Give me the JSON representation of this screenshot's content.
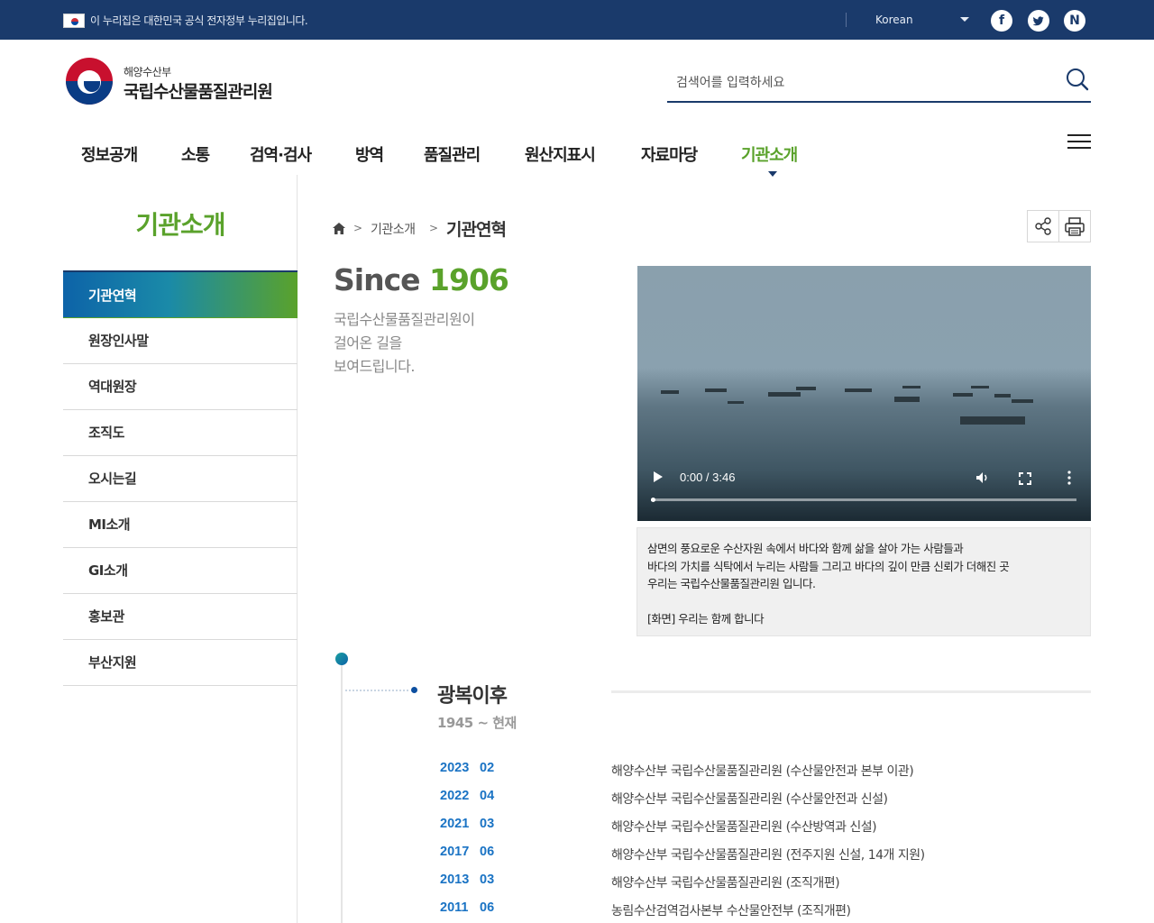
{
  "topbar": {
    "notice": "이 누리집은 대한민국 공식 전자정부 누리집입니다.",
    "language": "Korean",
    "sns": [
      "f",
      "t",
      "N"
    ]
  },
  "header": {
    "org_sub": "해양수산부",
    "org_name": "국립수산물품질관리원",
    "search_placeholder": "검색어를 입력하세요"
  },
  "gnb": [
    {
      "label": "정보공개"
    },
    {
      "label": "소통"
    },
    {
      "label": "검역·검사"
    },
    {
      "label": "방역"
    },
    {
      "label": "품질관리"
    },
    {
      "label": "원산지표시"
    },
    {
      "label": "자료마당"
    },
    {
      "label": "기관소개",
      "active": true
    }
  ],
  "lnb": {
    "title": "기관소개",
    "items": [
      {
        "label": "기관연혁",
        "active": true
      },
      {
        "label": "원장인사말"
      },
      {
        "label": "역대원장"
      },
      {
        "label": "조직도"
      },
      {
        "label": "오시는길"
      },
      {
        "label": "MI소개"
      },
      {
        "label": "GI소개"
      },
      {
        "label": "홍보관"
      },
      {
        "label": "부산지원"
      }
    ]
  },
  "breadcrumb": {
    "level1": "기관소개",
    "current": "기관연혁",
    "separator": ">"
  },
  "intro": {
    "since_text": "Since",
    "since_year": "1906",
    "line1": "국립수산물품질관리원이",
    "line2": "걸어온 길을",
    "line3": "보여드립니다."
  },
  "video": {
    "time": "0:00 / 3:46",
    "progress": 0
  },
  "caption": {
    "line1": "삼면의 풍요로운 수산자원 속에서 바다와 함께 삶을 살아 가는 사람들과",
    "line2": "바다의 가치를 식탁에서 누리는 사람들 그리고 바다의 깊이 만큼 신뢰가 더해진 곳",
    "line3": "우리는 국립수산물품질관리원 입니다.",
    "line4": "[화면] 우리는 함께 합니다"
  },
  "timeline": {
    "era_title": "광복이후",
    "era_range": "1945 ~ 현재",
    "events": [
      {
        "year": "2023",
        "month": "02",
        "desc": "해양수산부 국립수산물품질관리원 (수산물안전과 본부 이관)"
      },
      {
        "year": "2022",
        "month": "04",
        "desc": "해양수산부 국립수산물품질관리원 (수산물안전과 신설)"
      },
      {
        "year": "2021",
        "month": "03",
        "desc": "해양수산부 국립수산물품질관리원 (수산방역과 신설)"
      },
      {
        "year": "2017",
        "month": "06",
        "desc": "해양수산부 국립수산물품질관리원 (전주지원 신설, 14개 지원)"
      },
      {
        "year": "2013",
        "month": "03",
        "desc": "해양수산부 국립수산물품질관리원 (조직개편)"
      },
      {
        "year": "2011",
        "month": "06",
        "desc": "농림수산검역검사본부 수산물안전부 (조직개편)"
      }
    ]
  },
  "colors": {
    "navy": "#1a3a6b",
    "green": "#5aa22b",
    "blue": "#1a73c4"
  }
}
